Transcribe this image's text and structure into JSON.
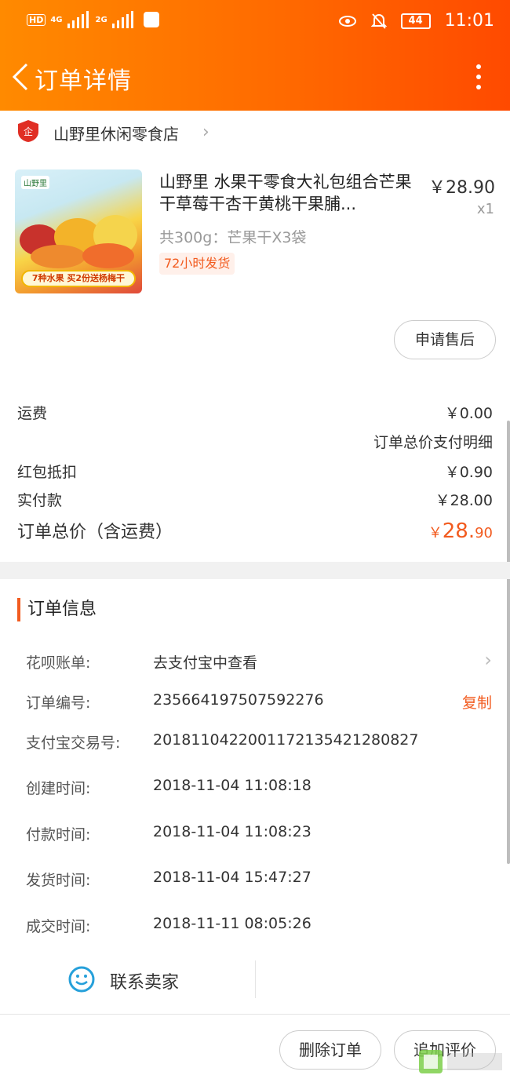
{
  "status_bar": {
    "hd": "HD",
    "sig1": "4G",
    "sig2": "2G",
    "battery": "44",
    "time": "11:01"
  },
  "header": {
    "title": "订单详情"
  },
  "shop": {
    "name": "山野里休闲零食店"
  },
  "product": {
    "title": "山野里 水果干零食大礼包组合芒果干草莓干杏干黄桃干果脯...",
    "price": "￥28.90",
    "qty": "x1",
    "spec": "共300g：芒果干X3袋",
    "tag": "72小时发货",
    "image_brand": "山野里",
    "image_banner": "7种水果   买2份送杨梅干"
  },
  "after_sale_button": "申请售后",
  "fees": {
    "shipping_label": "运费",
    "shipping_value": "￥0.00",
    "detail_link": "订单总价支付明细",
    "redpacket_label": "红包抵扣",
    "redpacket_value": "￥0.90",
    "paid_label": "实付款",
    "paid_value": "￥28.00",
    "total_label": "订单总价（含运费）",
    "total_currency": "￥",
    "total_int": "28.",
    "total_dec": "90"
  },
  "order_info": {
    "section_title": "订单信息",
    "rows": [
      {
        "label": "花呗账单:",
        "value": "去支付宝中查看"
      },
      {
        "label": "订单编号:",
        "value": "235664197507592276",
        "action": "复制"
      },
      {
        "label": "支付宝交易号:",
        "value": "2018110422001172135421280827"
      },
      {
        "label": "创建时间:",
        "value": "2018-11-04 11:08:18"
      },
      {
        "label": "付款时间:",
        "value": "2018-11-04 11:08:23"
      },
      {
        "label": "发货时间:",
        "value": "2018-11-04 15:47:27"
      },
      {
        "label": "成交时间:",
        "value": "2018-11-11 08:05:26"
      }
    ]
  },
  "contact_seller": "联系卖家",
  "buttons": {
    "delete_order": "删除订单",
    "add_review": "追加评价"
  },
  "colors": {
    "header_start": "#ff8a00",
    "header_end": "#ff4a00",
    "accent": "#f25b1f"
  }
}
